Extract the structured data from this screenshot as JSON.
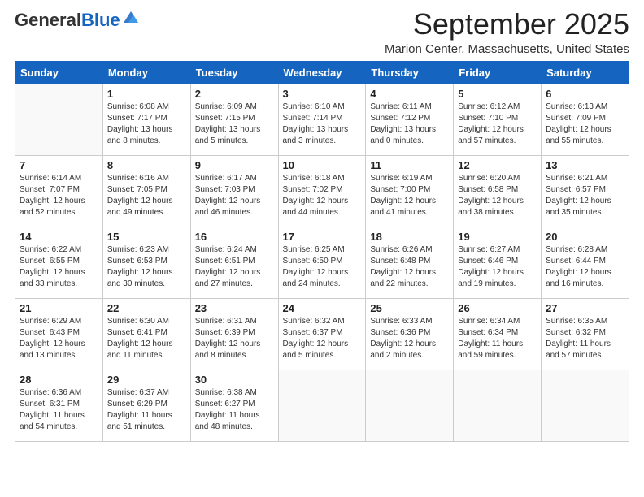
{
  "logo": {
    "general": "General",
    "blue": "Blue"
  },
  "header": {
    "month": "September 2025",
    "location": "Marion Center, Massachusetts, United States"
  },
  "weekdays": [
    "Sunday",
    "Monday",
    "Tuesday",
    "Wednesday",
    "Thursday",
    "Friday",
    "Saturday"
  ],
  "weeks": [
    [
      {
        "day": "",
        "info": ""
      },
      {
        "day": "1",
        "info": "Sunrise: 6:08 AM\nSunset: 7:17 PM\nDaylight: 13 hours\nand 8 minutes."
      },
      {
        "day": "2",
        "info": "Sunrise: 6:09 AM\nSunset: 7:15 PM\nDaylight: 13 hours\nand 5 minutes."
      },
      {
        "day": "3",
        "info": "Sunrise: 6:10 AM\nSunset: 7:14 PM\nDaylight: 13 hours\nand 3 minutes."
      },
      {
        "day": "4",
        "info": "Sunrise: 6:11 AM\nSunset: 7:12 PM\nDaylight: 13 hours\nand 0 minutes."
      },
      {
        "day": "5",
        "info": "Sunrise: 6:12 AM\nSunset: 7:10 PM\nDaylight: 12 hours\nand 57 minutes."
      },
      {
        "day": "6",
        "info": "Sunrise: 6:13 AM\nSunset: 7:09 PM\nDaylight: 12 hours\nand 55 minutes."
      }
    ],
    [
      {
        "day": "7",
        "info": "Sunrise: 6:14 AM\nSunset: 7:07 PM\nDaylight: 12 hours\nand 52 minutes."
      },
      {
        "day": "8",
        "info": "Sunrise: 6:16 AM\nSunset: 7:05 PM\nDaylight: 12 hours\nand 49 minutes."
      },
      {
        "day": "9",
        "info": "Sunrise: 6:17 AM\nSunset: 7:03 PM\nDaylight: 12 hours\nand 46 minutes."
      },
      {
        "day": "10",
        "info": "Sunrise: 6:18 AM\nSunset: 7:02 PM\nDaylight: 12 hours\nand 44 minutes."
      },
      {
        "day": "11",
        "info": "Sunrise: 6:19 AM\nSunset: 7:00 PM\nDaylight: 12 hours\nand 41 minutes."
      },
      {
        "day": "12",
        "info": "Sunrise: 6:20 AM\nSunset: 6:58 PM\nDaylight: 12 hours\nand 38 minutes."
      },
      {
        "day": "13",
        "info": "Sunrise: 6:21 AM\nSunset: 6:57 PM\nDaylight: 12 hours\nand 35 minutes."
      }
    ],
    [
      {
        "day": "14",
        "info": "Sunrise: 6:22 AM\nSunset: 6:55 PM\nDaylight: 12 hours\nand 33 minutes."
      },
      {
        "day": "15",
        "info": "Sunrise: 6:23 AM\nSunset: 6:53 PM\nDaylight: 12 hours\nand 30 minutes."
      },
      {
        "day": "16",
        "info": "Sunrise: 6:24 AM\nSunset: 6:51 PM\nDaylight: 12 hours\nand 27 minutes."
      },
      {
        "day": "17",
        "info": "Sunrise: 6:25 AM\nSunset: 6:50 PM\nDaylight: 12 hours\nand 24 minutes."
      },
      {
        "day": "18",
        "info": "Sunrise: 6:26 AM\nSunset: 6:48 PM\nDaylight: 12 hours\nand 22 minutes."
      },
      {
        "day": "19",
        "info": "Sunrise: 6:27 AM\nSunset: 6:46 PM\nDaylight: 12 hours\nand 19 minutes."
      },
      {
        "day": "20",
        "info": "Sunrise: 6:28 AM\nSunset: 6:44 PM\nDaylight: 12 hours\nand 16 minutes."
      }
    ],
    [
      {
        "day": "21",
        "info": "Sunrise: 6:29 AM\nSunset: 6:43 PM\nDaylight: 12 hours\nand 13 minutes."
      },
      {
        "day": "22",
        "info": "Sunrise: 6:30 AM\nSunset: 6:41 PM\nDaylight: 12 hours\nand 11 minutes."
      },
      {
        "day": "23",
        "info": "Sunrise: 6:31 AM\nSunset: 6:39 PM\nDaylight: 12 hours\nand 8 minutes."
      },
      {
        "day": "24",
        "info": "Sunrise: 6:32 AM\nSunset: 6:37 PM\nDaylight: 12 hours\nand 5 minutes."
      },
      {
        "day": "25",
        "info": "Sunrise: 6:33 AM\nSunset: 6:36 PM\nDaylight: 12 hours\nand 2 minutes."
      },
      {
        "day": "26",
        "info": "Sunrise: 6:34 AM\nSunset: 6:34 PM\nDaylight: 11 hours\nand 59 minutes."
      },
      {
        "day": "27",
        "info": "Sunrise: 6:35 AM\nSunset: 6:32 PM\nDaylight: 11 hours\nand 57 minutes."
      }
    ],
    [
      {
        "day": "28",
        "info": "Sunrise: 6:36 AM\nSunset: 6:31 PM\nDaylight: 11 hours\nand 54 minutes."
      },
      {
        "day": "29",
        "info": "Sunrise: 6:37 AM\nSunset: 6:29 PM\nDaylight: 11 hours\nand 51 minutes."
      },
      {
        "day": "30",
        "info": "Sunrise: 6:38 AM\nSunset: 6:27 PM\nDaylight: 11 hours\nand 48 minutes."
      },
      {
        "day": "",
        "info": ""
      },
      {
        "day": "",
        "info": ""
      },
      {
        "day": "",
        "info": ""
      },
      {
        "day": "",
        "info": ""
      }
    ]
  ]
}
